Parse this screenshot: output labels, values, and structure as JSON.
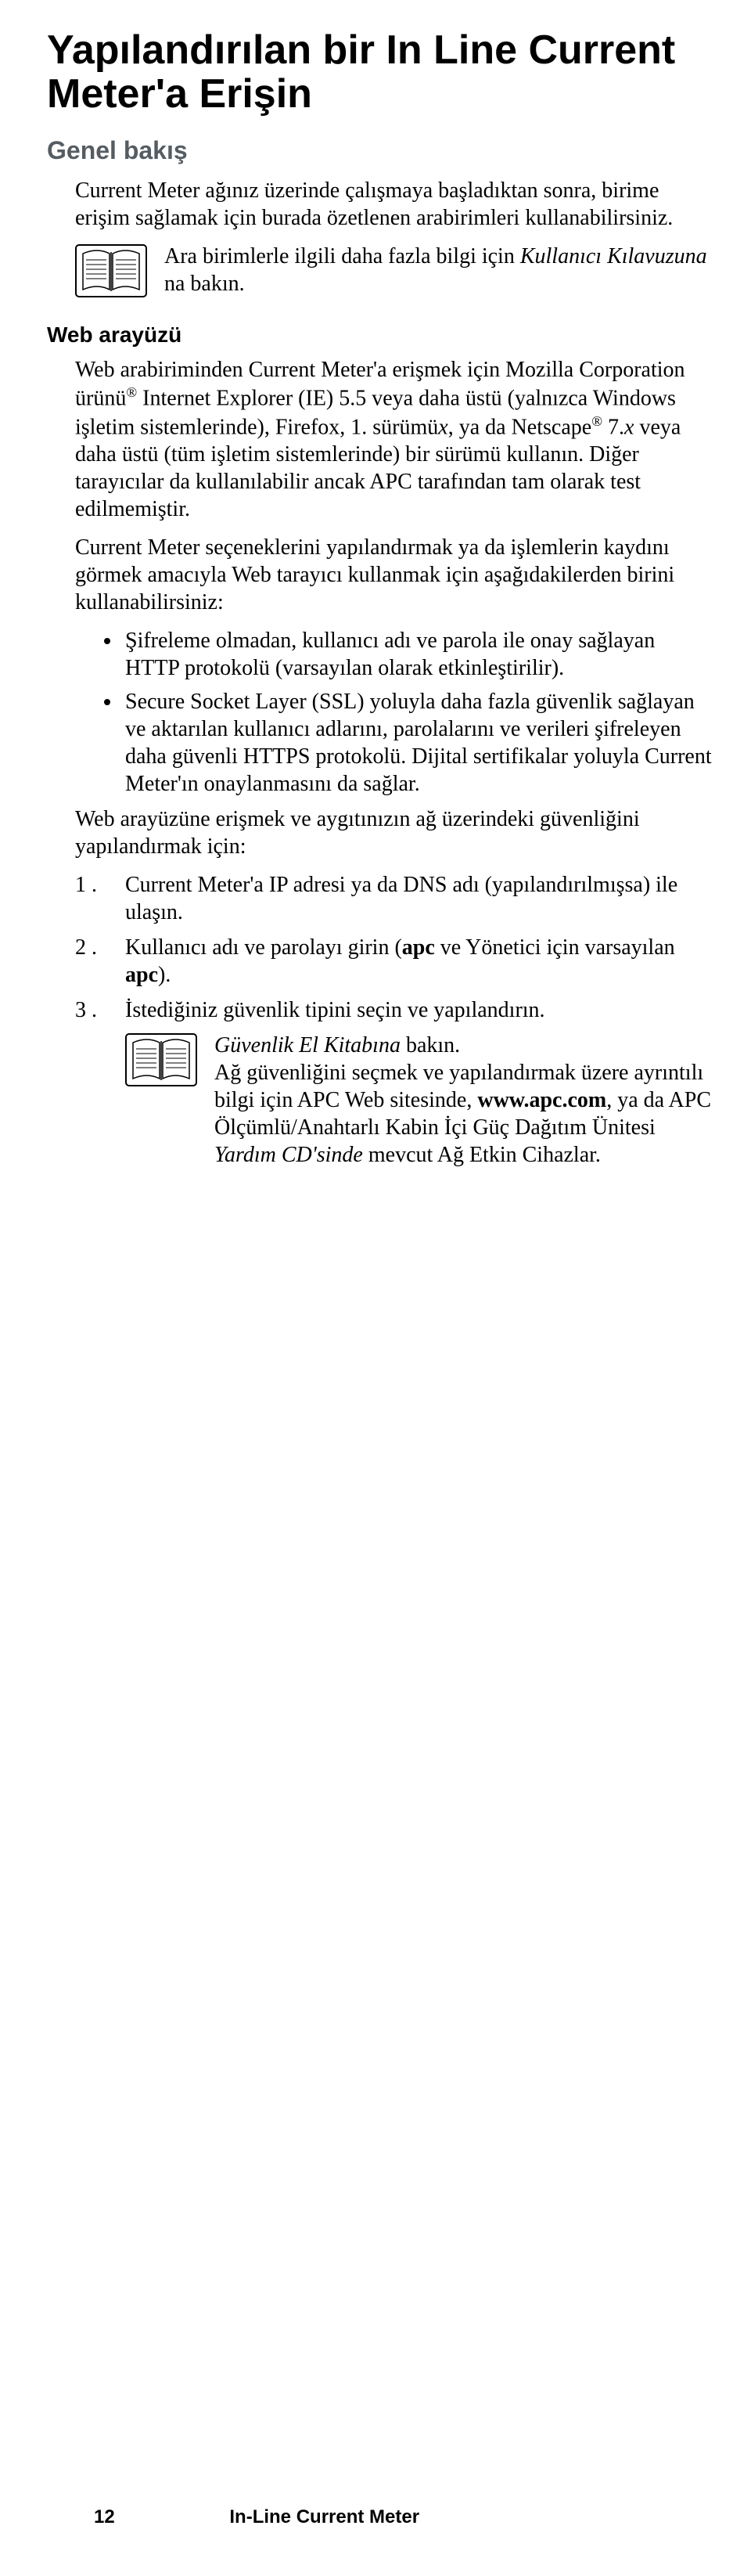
{
  "title": "Yapılandırılan bir In Line Current Meter'a Erişin",
  "s1": {
    "heading": "Genel bakış",
    "p1": "Current Meter ağınız üzerinde çalışmaya başladıktan sonra, birime erişim sağlamak için burada özetlenen arabirimleri kullanabilirsiniz.",
    "note_a": "Ara birimlerle ilgili daha fazla bilgi için ",
    "note_b": "Kullanıcı Kılavuzuna",
    "note_c": " na bakın."
  },
  "s2": {
    "heading": "Web arayüzü",
    "p1_a": "Web arabiriminden Current Meter'a erişmek için Mozilla Corporation ürünü",
    "p1_b": " Internet Explorer (IE) 5.5 veya daha üstü (yalnızca Windows işletim sistemlerinde), Firefox, 1. sürümü",
    "p1_c": ", ya da Netscape",
    "p1_d": " 7.",
    "p1_e": " veya daha üstü (tüm işletim sistemlerinde) bir sürümü kullanın. Diğer tarayıcılar da kullanılabilir ancak APC tarafından tam olarak test edilmemiştir.",
    "p1_x1": "x",
    "p1_x2": "x",
    "p2": "Current Meter seçeneklerini yapılandırmak ya da işlemlerin kaydını görmek amacıyla Web tarayıcı kullanmak için aşağıdakilerden birini kullanabilirsiniz:",
    "bullets": [
      "Şifreleme olmadan, kullanıcı adı ve parola ile onay sağlayan HTTP protokolü (varsayılan olarak etkinleştirilir).",
      "Secure Socket Layer (SSL) yoluyla daha fazla güvenlik sağlayan ve aktarılan kullanıcı adlarını, parolalarını ve verileri şifreleyen daha güvenli HTTPS protokolü. Dijital sertifikalar yoluyla Current Meter'ın onaylanmasını da sağlar."
    ],
    "p3": "Web arayüzüne erişmek ve aygıtınızın ağ üzerindeki güvenliğini yapılandırmak için:",
    "steps": [
      "Current Meter'a IP adresi ya da DNS adı (yapılandırılmışsa) ile ulaşın.",
      "Kullanıcı adı ve parolayı girin (apc ve Yönetici için varsayılan apc).",
      "İstediğiniz güvenlik tipini seçin ve yapılandırın."
    ],
    "note2_a": "Güvenlik El Kitabına",
    "note2_b": " bakın.",
    "note2_rest_a": "Ağ güvenliğini seçmek ve yapılandırmak üzere ayrıntılı bilgi için APC Web sitesinde, ",
    "note2_site": "www.apc.com",
    "note2_rest_b": ", ya da APC Ölçümlü/Anahtarlı Kabin İçi Güç Dağıtım Ünitesi ",
    "note2_cd": "Yardım CD'sinde",
    "note2_rest_c": " mevcut Ağ Etkin Cihazlar."
  },
  "footer": {
    "page": "12",
    "title": "In-Line Current Meter"
  }
}
